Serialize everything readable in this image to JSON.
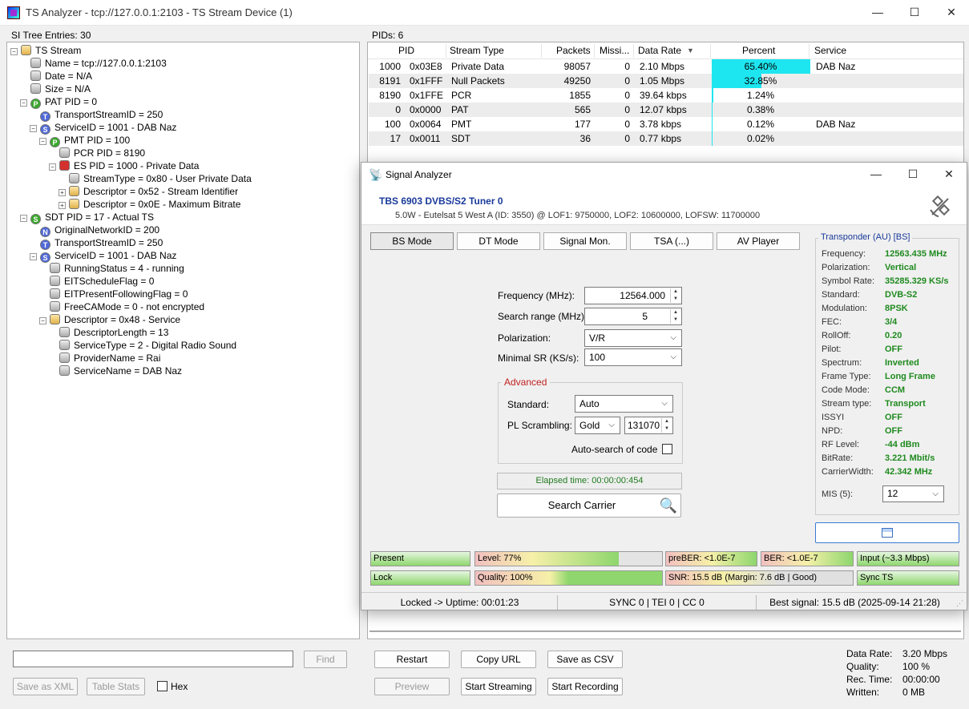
{
  "window": {
    "title": "TS Analyzer - tcp://127.0.0.1:2103 - TS Stream Device (1)"
  },
  "si_tree": {
    "header": "SI Tree Entries: 30",
    "items": [
      {
        "text": "TS Stream",
        "depth": 0,
        "icon": "folder",
        "expand": "−"
      },
      {
        "text": "Name = tcp://127.0.0.1:2103",
        "depth": 1,
        "icon": "grey"
      },
      {
        "text": "Date = N/A",
        "depth": 1,
        "icon": "grey"
      },
      {
        "text": "Size = N/A",
        "depth": 1,
        "icon": "grey"
      },
      {
        "text": "PAT PID = 0",
        "depth": 1,
        "icon": "green",
        "letter": "P",
        "expand": "−"
      },
      {
        "text": "TransportStreamID = 250",
        "depth": 2,
        "icon": "blue",
        "letter": "T"
      },
      {
        "text": "ServiceID = 1001 - DAB Naz",
        "depth": 2,
        "icon": "blue",
        "letter": "S",
        "expand": "−"
      },
      {
        "text": "PMT PID = 100",
        "depth": 3,
        "icon": "green",
        "letter": "P",
        "expand": "−"
      },
      {
        "text": "PCR PID = 8190",
        "depth": 4,
        "icon": "grey"
      },
      {
        "text": "ES PID = 1000 - Private Data",
        "depth": 4,
        "icon": "red",
        "expand": "−"
      },
      {
        "text": "StreamType = 0x80 - User Private Data",
        "depth": 5,
        "icon": "grey"
      },
      {
        "text": "Descriptor = 0x52 - Stream Identifier",
        "depth": 5,
        "icon": "folder",
        "expand": "+"
      },
      {
        "text": "Descriptor = 0x0E - Maximum Bitrate",
        "depth": 5,
        "icon": "folder",
        "expand": "+"
      },
      {
        "text": "SDT PID = 17 - Actual TS",
        "depth": 1,
        "icon": "green",
        "letter": "S",
        "expand": "−"
      },
      {
        "text": "OriginalNetworkID = 200",
        "depth": 2,
        "icon": "blue",
        "letter": "N"
      },
      {
        "text": "TransportStreamID = 250",
        "depth": 2,
        "icon": "blue",
        "letter": "T"
      },
      {
        "text": "ServiceID = 1001 - DAB Naz",
        "depth": 2,
        "icon": "blue",
        "letter": "S",
        "expand": "−"
      },
      {
        "text": "RunningStatus = 4 - running",
        "depth": 3,
        "icon": "grey"
      },
      {
        "text": "EITScheduleFlag = 0",
        "depth": 3,
        "icon": "grey"
      },
      {
        "text": "EITPresentFollowingFlag = 0",
        "depth": 3,
        "icon": "grey"
      },
      {
        "text": "FreeCAMode = 0 - not encrypted",
        "depth": 3,
        "icon": "grey"
      },
      {
        "text": "Descriptor = 0x48 - Service",
        "depth": 3,
        "icon": "folder",
        "expand": "−"
      },
      {
        "text": "DescriptorLength = 13",
        "depth": 4,
        "icon": "grey"
      },
      {
        "text": "ServiceType = 2 - Digital Radio Sound",
        "depth": 4,
        "icon": "grey"
      },
      {
        "text": "ProviderName = Rai",
        "depth": 4,
        "icon": "grey"
      },
      {
        "text": "ServiceName = DAB Naz",
        "depth": 4,
        "icon": "grey"
      }
    ],
    "search_value": "",
    "find_label": "Find",
    "save_xml_label": "Save as XML",
    "table_stats_label": "Table Stats",
    "hex_label": "Hex"
  },
  "pids": {
    "header": "PIDs: 6",
    "columns": [
      "PID",
      "Stream Type",
      "Packets",
      "Missi...",
      "Data Rate",
      "Percent",
      "Service"
    ],
    "sort_indicator": "▼",
    "rows": [
      {
        "pid": "1000",
        "hex": "0x03E8",
        "type": "Private Data",
        "packets": "98057",
        "missing": "0",
        "rate": "2.10 Mbps",
        "percent": "65.40%",
        "pct": 65.4,
        "service": "DAB Naz"
      },
      {
        "pid": "8191",
        "hex": "0x1FFF",
        "type": "Null Packets",
        "packets": "49250",
        "missing": "0",
        "rate": "1.05 Mbps",
        "percent": "32.85%",
        "pct": 32.85,
        "service": ""
      },
      {
        "pid": "8190",
        "hex": "0x1FFE",
        "type": "PCR",
        "packets": "1855",
        "missing": "0",
        "rate": "39.64 kbps",
        "percent": "1.24%",
        "pct": 1.24,
        "service": ""
      },
      {
        "pid": "0",
        "hex": "0x0000",
        "type": "PAT",
        "packets": "565",
        "missing": "0",
        "rate": "12.07 kbps",
        "percent": "0.38%",
        "pct": 0.38,
        "service": ""
      },
      {
        "pid": "100",
        "hex": "0x0064",
        "type": "PMT",
        "packets": "177",
        "missing": "0",
        "rate": "3.78 kbps",
        "percent": "0.12%",
        "pct": 0.12,
        "service": "DAB Naz"
      },
      {
        "pid": "17",
        "hex": "0x0011",
        "type": "SDT",
        "packets": "36",
        "missing": "0",
        "rate": "0.77 kbps",
        "percent": "0.02%",
        "pct": 0.02,
        "service": ""
      }
    ]
  },
  "bottom": {
    "restart": "Restart",
    "copy_url": "Copy URL",
    "save_csv": "Save as CSV",
    "preview": "Preview",
    "start_streaming": "Start Streaming",
    "start_recording": "Start Recording",
    "stats": [
      {
        "k": "Data Rate:",
        "v": "3.20 Mbps"
      },
      {
        "k": "Quality:",
        "v": "100 %"
      },
      {
        "k": "Rec. Time:",
        "v": "00:00:00"
      },
      {
        "k": "Written:",
        "v": "0 MB"
      }
    ]
  },
  "signal": {
    "title": "Signal Analyzer",
    "tuner": "TBS 6903 DVBS/S2 Tuner 0",
    "tuner_info": "5.0W - Eutelsat 5 West A (ID: 3550) @ LOF1: 9750000, LOF2: 10600000, LOFSW: 11700000",
    "tabs": [
      "BS Mode",
      "DT Mode",
      "Signal Mon.",
      "TSA (...)",
      "AV Player"
    ],
    "fields": {
      "frequency_label": "Frequency (MHz):",
      "frequency": "12564.000",
      "range_label": "Search range (MHz):",
      "range": "5",
      "pol_label": "Polarization:",
      "pol": "V/R",
      "minsr_label": "Minimal SR (KS/s):",
      "minsr": "100"
    },
    "advanced": {
      "title": "Advanced",
      "standard_label": "Standard:",
      "standard": "Auto",
      "pls_label": "PL Scrambling:",
      "pls_mode": "Gold",
      "pls_code": "131070",
      "autosearch_label": "Auto-search of code"
    },
    "elapsed": "Elapsed time: 00:00:00:454",
    "search_label": "Search Carrier",
    "transponder": {
      "title": "Transponder (AU) [BS]",
      "rows": [
        {
          "k": "Frequency:",
          "v": "12563.435 MHz"
        },
        {
          "k": "Polarization:",
          "v": "Vertical"
        },
        {
          "k": "Symbol Rate:",
          "v": "35285.329 KS/s"
        },
        {
          "k": "Standard:",
          "v": "DVB-S2"
        },
        {
          "k": "Modulation:",
          "v": "8PSK"
        },
        {
          "k": "FEC:",
          "v": "3/4"
        },
        {
          "k": "RollOff:",
          "v": "0.20"
        },
        {
          "k": "Pilot:",
          "v": "OFF"
        },
        {
          "k": "Spectrum:",
          "v": "Inverted"
        },
        {
          "k": "Frame Type:",
          "v": "Long Frame"
        },
        {
          "k": "Code Mode:",
          "v": "CCM"
        },
        {
          "k": "Stream type:",
          "v": "Transport"
        },
        {
          "k": "ISSYI",
          "v": "OFF"
        },
        {
          "k": "NPD:",
          "v": "OFF"
        },
        {
          "k": "RF Level:",
          "v": "-44 dBm"
        },
        {
          "k": "BitRate:",
          "v": "3.221 Mbit/s"
        },
        {
          "k": "CarrierWidth:",
          "v": "42.342 MHz"
        }
      ],
      "mis_label": "MIS (5):",
      "mis": "12"
    },
    "meters": {
      "present": "Present",
      "level": "Level: 77%",
      "level_pct": 77,
      "preber": "preBER: <1.0E-7",
      "ber": "BER: <1.0E-7",
      "input": "Input (~3.3 Mbps)",
      "lock": "Lock",
      "quality": "Quality: 100%",
      "quality_pct": 100,
      "snr": "SNR: 15.5 dB (Margin: 7.6 dB | Good)",
      "sync": "Sync TS"
    },
    "status": {
      "uptime": "Locked -> Uptime: 00:01:23",
      "sync": "SYNC 0 | TEI 0 | CC 0",
      "best": "Best signal: 15.5 dB (2025-09-14 21:28)"
    }
  }
}
